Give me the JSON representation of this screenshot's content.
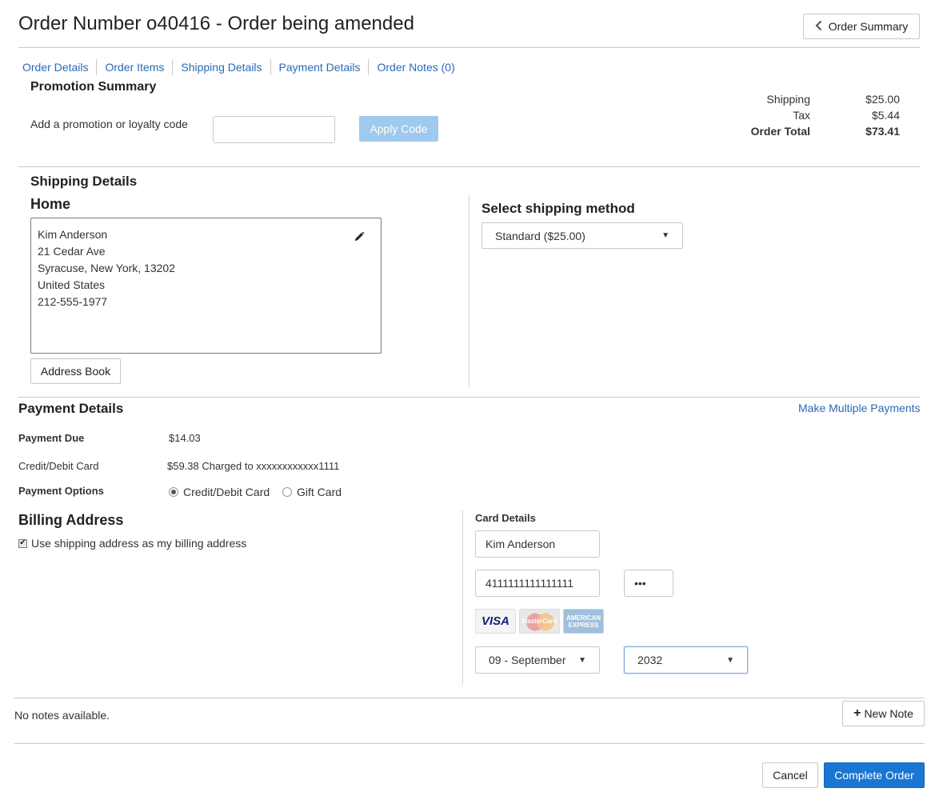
{
  "header": {
    "title": "Order Number o40416 - Order being amended",
    "summary_button": "Order Summary"
  },
  "tabs": [
    {
      "label": "Order Details"
    },
    {
      "label": "Order Items"
    },
    {
      "label": "Shipping Details"
    },
    {
      "label": "Payment Details"
    },
    {
      "label": "Order Notes (0)"
    }
  ],
  "promotion": {
    "title": "Promotion Summary",
    "prompt": "Add a promotion or loyalty code",
    "input_value": "",
    "apply_label": "Apply Code"
  },
  "totals": {
    "shipping_label": "Shipping",
    "shipping_value": "$25.00",
    "tax_label": "Tax",
    "tax_value": "$5.44",
    "total_label": "Order Total",
    "total_value": "$73.41"
  },
  "shipping": {
    "title": "Shipping Details",
    "address_title": "Home",
    "address_lines": [
      "Kim Anderson",
      "21 Cedar Ave",
      "Syracuse, New York, 13202",
      "United States",
      "212-555-1977"
    ],
    "address_book_label": "Address Book",
    "method_title": "Select shipping method",
    "method_selected": "Standard ($25.00)"
  },
  "payment": {
    "title": "Payment Details",
    "multiple_link": "Make Multiple Payments",
    "due_label": "Payment Due",
    "due_value": "$14.03",
    "card_label": "Credit/Debit Card",
    "card_value": "$59.38 Charged to xxxxxxxxxxxx1111",
    "options_label": "Payment Options",
    "option_card": "Credit/Debit Card",
    "option_gift": "Gift Card",
    "option_selected": "Credit/Debit Card"
  },
  "billing": {
    "title": "Billing Address",
    "use_shipping_label": "Use shipping address as my billing address",
    "use_shipping_checked": true
  },
  "card": {
    "title": "Card Details",
    "name": "Kim Anderson",
    "number": "4111111111111111",
    "cvv": "•••",
    "logos": [
      "VISA",
      "MasterCard",
      "AMERICAN EXPRESS"
    ],
    "exp_month": "09 - September",
    "exp_year": "2032"
  },
  "notes": {
    "empty_text": "No notes available.",
    "new_note_label": "New Note"
  },
  "footer": {
    "cancel_label": "Cancel",
    "complete_label": "Complete Order"
  },
  "colors": {
    "link": "#2a6ab3",
    "primary": "#1976d2",
    "apply_disabled": "#9fc9ee"
  }
}
